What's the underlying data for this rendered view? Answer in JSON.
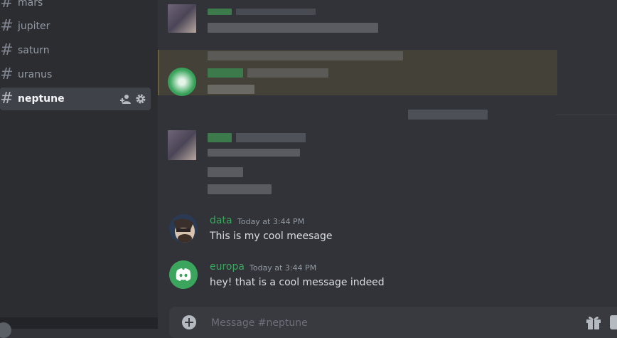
{
  "sidebar": {
    "channels": [
      {
        "name": "mars"
      },
      {
        "name": "jupiter"
      },
      {
        "name": "saturn"
      },
      {
        "name": "uranus"
      },
      {
        "name": "neptune",
        "active": true
      }
    ]
  },
  "messages": [
    {
      "author": "data",
      "timestamp": "Today at 3:44 PM",
      "text": "This is my cool meesage"
    },
    {
      "author": "europa",
      "timestamp": "Today at 3:44 PM",
      "text": "hey! that is a cool message indeed"
    }
  ],
  "composer": {
    "placeholder": "Message #neptune"
  },
  "colors": {
    "accent_author": "#3ba55d",
    "discord_blurple": "#3ba55d",
    "highlight": "#444139"
  },
  "icons": [
    "hash-icon",
    "add-member-icon",
    "gear-icon",
    "discord-logo-icon",
    "plus-circle-icon",
    "gift-icon"
  ]
}
